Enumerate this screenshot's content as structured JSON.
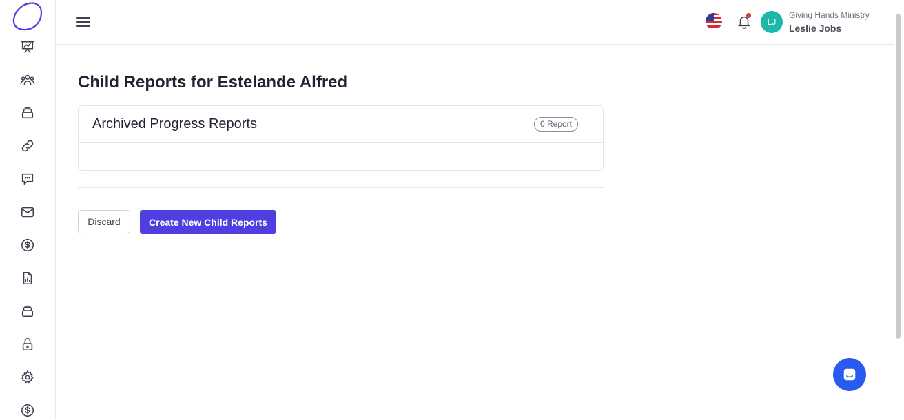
{
  "sidebar": {
    "icons": [
      "presentation-chart-icon",
      "users-group-icon",
      "box-stack-icon",
      "link-icon",
      "chat-bubble-icon",
      "mail-icon",
      "dollar-circle-icon",
      "report-document-icon",
      "box-stack-icon",
      "lock-icon",
      "gear-icon",
      "dollar-circle-icon"
    ]
  },
  "header": {
    "organization": "Giving Hands Ministry",
    "user_name": "Leslie Jobs",
    "avatar_initials": "LJ"
  },
  "main": {
    "title": "Child Reports for Estelande Alfred",
    "card": {
      "title": "Archived Progress Reports",
      "badge": "0 Report"
    },
    "buttons": {
      "discard": "Discard",
      "create": "Create New Child Reports"
    }
  },
  "colors": {
    "primary": "#4f3fe0",
    "chat": "#2a5bf0",
    "avatar": "#1db8a8",
    "notification": "#e0353c"
  }
}
